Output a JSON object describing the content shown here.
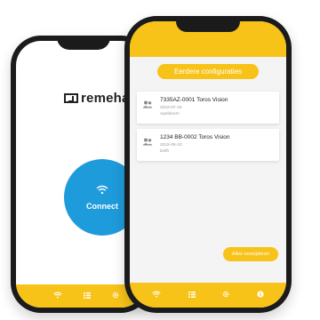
{
  "back_screen": {
    "logo_text": "remeha",
    "connect_label": "Connect",
    "tabbar": [
      "wifi-icon",
      "list-icon",
      "gear-icon"
    ]
  },
  "front_screen": {
    "title": "Eerdere configuraties",
    "configurations": [
      {
        "name": "7335AZ-0001 Toros Vision",
        "date": "2022-07-19",
        "city": "Apeldoorn"
      },
      {
        "name": "1234 BB-0002 Toros Vision",
        "date": "2022-08-10",
        "city": "Delft"
      }
    ],
    "remove_all_label": "Alles verwijderen",
    "tabbar": [
      "wifi-icon",
      "list-icon",
      "gear-icon",
      "info-icon"
    ]
  },
  "colors": {
    "accent": "#f8c318",
    "connect": "#1e9bdb"
  }
}
